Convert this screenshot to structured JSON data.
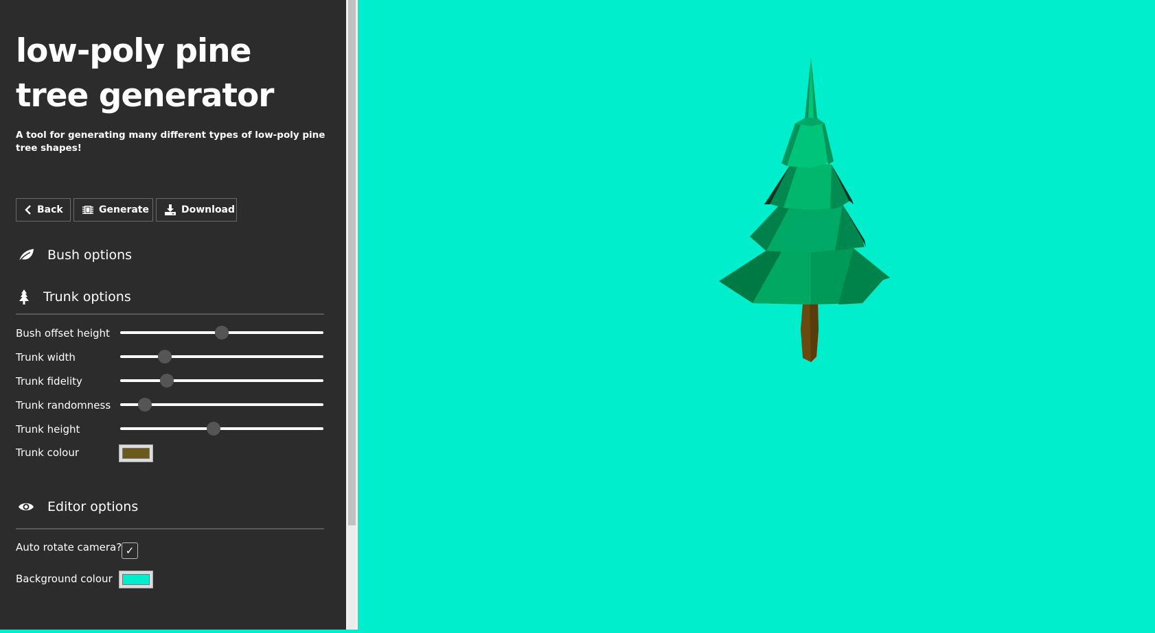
{
  "sidebar": {
    "title": "low-poly pine tree generator",
    "subtitle": "A tool for generating many different types of low-poly pine tree shapes!",
    "buttons": {
      "back": "Back",
      "generate": "Generate",
      "download": "Download"
    },
    "sections": {
      "bush": {
        "label": "Bush options",
        "icon": "leaf-icon"
      },
      "trunk": {
        "label": "Trunk options",
        "icon": "pine-tree-icon"
      },
      "editor": {
        "label": "Editor options",
        "icon": "eye-icon"
      }
    },
    "trunk_options": {
      "sliders": [
        {
          "label": "Bush offset height",
          "value": 0.5
        },
        {
          "label": "Trunk width",
          "value": 0.22
        },
        {
          "label": "Trunk fidelity",
          "value": 0.23
        },
        {
          "label": "Trunk randomness",
          "value": 0.12
        },
        {
          "label": "Trunk height",
          "value": 0.46
        }
      ],
      "colour_label": "Trunk colour",
      "colour_value": "#6b5a1e"
    },
    "editor_options": {
      "auto_rotate_label": "Auto rotate camera?",
      "auto_rotate_checked": true,
      "background_label": "Background colour",
      "background_value": "#00eecc"
    }
  },
  "scene": {
    "background": "#00eecc",
    "foliage_color": "#00b36b",
    "trunk_color": "#6b4a12"
  }
}
